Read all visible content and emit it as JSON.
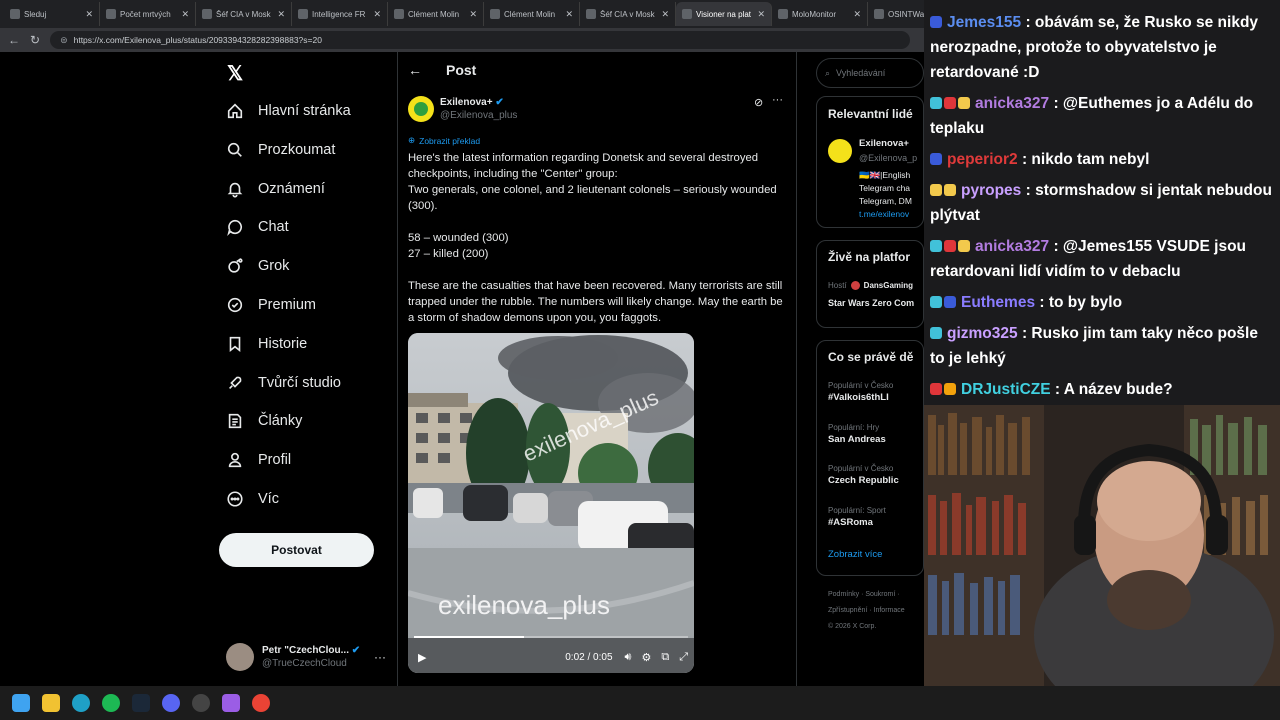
{
  "browser": {
    "tabs": [
      {
        "title": "Sleduj",
        "active": false
      },
      {
        "title": "Počet mrtvých",
        "active": false
      },
      {
        "title": "Šéf CIA v Mosk",
        "active": false
      },
      {
        "title": "Intelligence FR",
        "active": false
      },
      {
        "title": "Clément Molin",
        "active": false
      },
      {
        "title": "Clément Molin",
        "active": false
      },
      {
        "title": "Šéf CIA v Mosk",
        "active": false
      },
      {
        "title": "Visioner na plat",
        "active": true
      },
      {
        "title": "MoloMonitor",
        "active": false
      },
      {
        "title": "OSINTWarfar",
        "active": false
      }
    ],
    "url": "https://x.com/Exilenova_plus/status/2093394328282398883?s=20"
  },
  "nav": {
    "items": [
      {
        "label": "Hlavní stránka",
        "icon": "home-icon"
      },
      {
        "label": "Prozkoumat",
        "icon": "search-icon"
      },
      {
        "label": "Oznámení",
        "icon": "bell-icon"
      },
      {
        "label": "Chat",
        "icon": "chat-icon"
      },
      {
        "label": "Grok",
        "icon": "grok-icon"
      },
      {
        "label": "Premium",
        "icon": "premium-icon"
      },
      {
        "label": "Historie",
        "icon": "bookmark-icon"
      },
      {
        "label": "Tvůrčí studio",
        "icon": "rocket-icon"
      },
      {
        "label": "Články",
        "icon": "article-icon"
      },
      {
        "label": "Profil",
        "icon": "person-icon"
      },
      {
        "label": "Víc",
        "icon": "more-circle-icon"
      }
    ],
    "post_button": "Postovat",
    "profile_name": "Petr \"CzechClou...",
    "profile_handle": "@TrueCzechCloud"
  },
  "post": {
    "header": "Post",
    "author_name": "Exilenova+",
    "author_handle": "@Exilenova_plus",
    "translate_label": "Zobrazit překlad",
    "text": "Here's the latest information regarding Donetsk and several destroyed checkpoints, including the \"Center\" group:\nTwo generals, one colonel, and 2 lieutenant colonels – seriously wounded (300).\n\n58 – wounded (300)\n27 – killed (200)\n\nThese are the casualties that have been recovered. Many terrorists are still trapped under the rubble. The numbers will likely change. May the earth be a storm of shadow demons upon you, you faggots.",
    "video": {
      "watermark_top": "exilenova_plus",
      "watermark_bottom": "exilenova_plus",
      "time": "0:02 / 0:05",
      "progress": 0.4
    }
  },
  "sidebar": {
    "search_placeholder": "Vyhledávání",
    "relevant_title": "Relevantní lidé",
    "relevant_name": "Exilenova+",
    "relevant_handle": "@Exilenova_p",
    "relevant_bio_1": "🇺🇦🇬🇧|English",
    "relevant_bio_2": "Telegram cha",
    "relevant_bio_3": "Telegram, DM",
    "relevant_link": "t.me/exilenov",
    "live_title": "Živě na platfor",
    "live_host_label": "Hostí",
    "live_host": "DansGaming",
    "live_show": "Star Wars Zero Com",
    "trending_title": "Co se právě dě",
    "trends": [
      {
        "meta": "Populární v Česko",
        "topic": "#Valkois6thLI"
      },
      {
        "meta": "Populární: Hry",
        "topic": "San Andreas"
      },
      {
        "meta": "Populární v Česko",
        "topic": "Czech Republic"
      },
      {
        "meta": "Populární: Sport",
        "topic": "#ASRoma"
      }
    ],
    "show_more": "Zobrazit více",
    "footer_1": "Podmínky · Soukromí ·",
    "footer_2": "Zpřístupnění · Informace",
    "footer_3": "© 2026 X Corp."
  },
  "chat": [
    {
      "user": "Jemes155",
      "color": "#5b8df0",
      "text": ": obávám se, že Rusko se nikdy nerozpadne, protože to obyvatelstvo je retardované :D"
    },
    {
      "user": "anicka327",
      "color": "#b27ce0",
      "text": ": @Euthemes jo a Adélu do teplaku"
    },
    {
      "user": "peperior2",
      "color": "#e03a3a",
      "text": ": nikdo tam nebyl"
    },
    {
      "user": "pyropes",
      "color": "#c9a0ff",
      "text": ": stormshadow si jentak nebudou plýtvat"
    },
    {
      "user": "anicka327",
      "color": "#b27ce0",
      "text": ": @Jemes155 VSUDE jsou retardovani lidí vidím to v debaclu"
    },
    {
      "user": "Euthemes",
      "color": "#8a7cff",
      "text": ": to by bylo"
    },
    {
      "user": "gizmo325",
      "color": "#c9a0ff",
      "text": ": Rusko jim tam taky něco pošle to je lehký"
    },
    {
      "user": "DRJustiCZE",
      "color": "#41d0e0",
      "text": ": A název bude?"
    }
  ]
}
